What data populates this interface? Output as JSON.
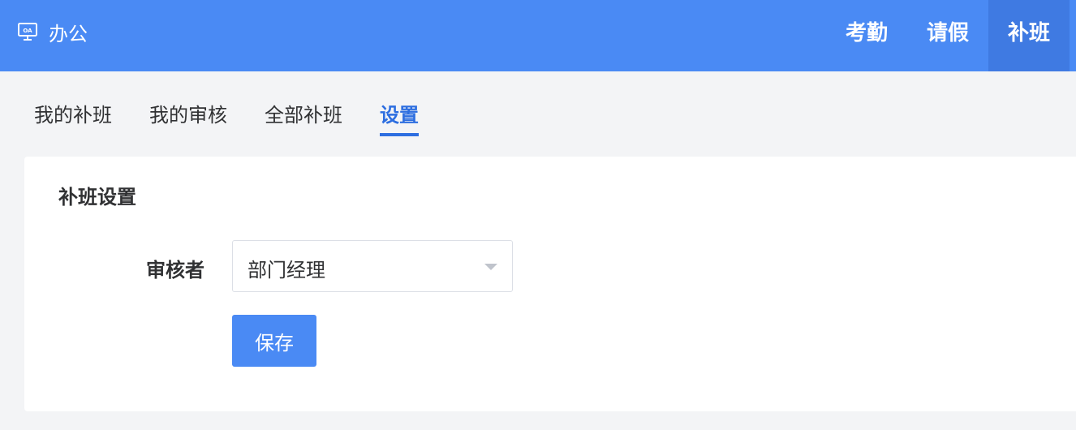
{
  "header": {
    "brand_label": "办公",
    "brand_icon": "monitor-oa-icon",
    "nav": [
      {
        "label": "考勤",
        "active": false
      },
      {
        "label": "请假",
        "active": false
      },
      {
        "label": "补班",
        "active": true
      }
    ],
    "background_color": "#4a8af4",
    "active_color": "#3f7ae2"
  },
  "subtabs": [
    {
      "label": "我的补班",
      "active": false
    },
    {
      "label": "我的审核",
      "active": false
    },
    {
      "label": "全部补班",
      "active": false
    },
    {
      "label": "设置",
      "active": true
    }
  ],
  "settings": {
    "title": "补班设置",
    "reviewer_label": "审核者",
    "reviewer_value": "部门经理",
    "save_label": "保存"
  },
  "accent_color": "#2d6ee0"
}
